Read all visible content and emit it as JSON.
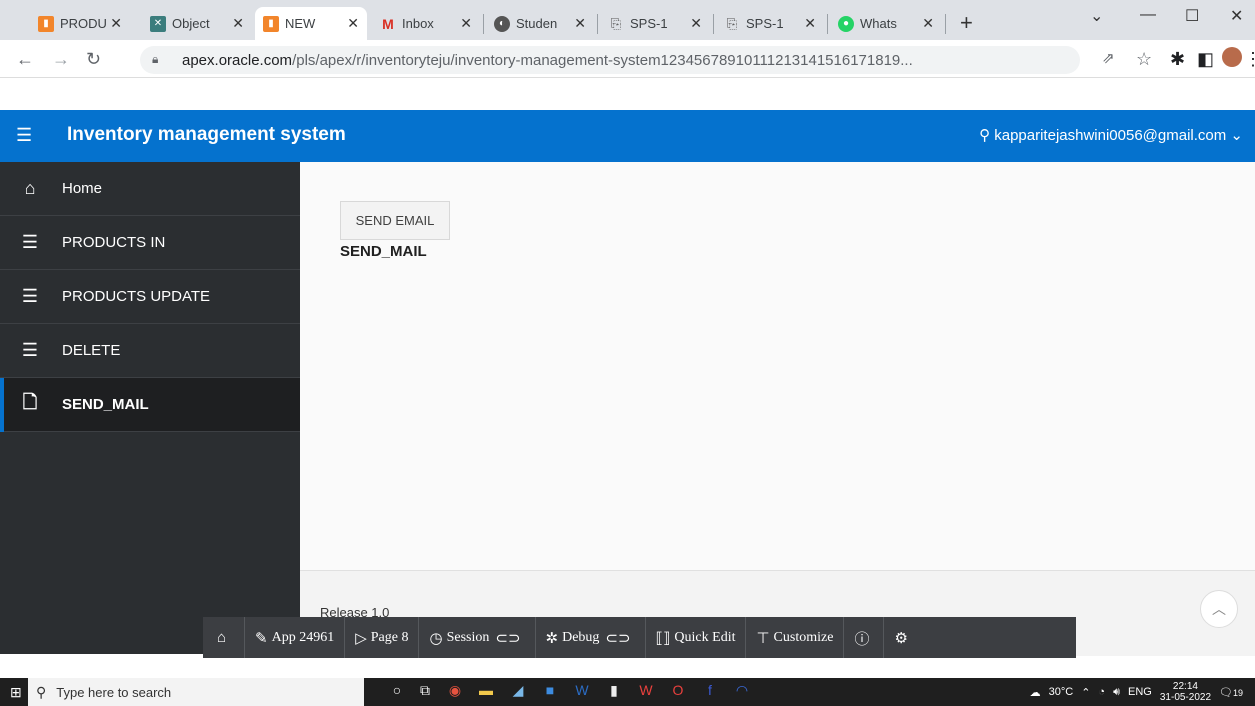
{
  "browser": {
    "tabs": [
      {
        "title": "PRODU",
        "favicon": "apex-icon",
        "color": "#f2852b",
        "active": false
      },
      {
        "title": "Object",
        "favicon": "object-icon",
        "color": "#3b7d7d",
        "active": false
      },
      {
        "title": "NEW",
        "favicon": "apex-icon",
        "color": "#f2852b",
        "active": true
      },
      {
        "title": "Inbox",
        "favicon": "gmail-icon",
        "color": "#d93025",
        "active": false
      },
      {
        "title": "Studen",
        "favicon": "globe-icon",
        "color": "#555555",
        "active": false
      },
      {
        "title": "SPS-1",
        "favicon": "doc-icon",
        "color": "#555555",
        "active": false
      },
      {
        "title": "SPS-1",
        "favicon": "doc-icon",
        "color": "#555555",
        "active": false
      },
      {
        "title": "Whats",
        "favicon": "whatsapp-icon",
        "color": "#25d366",
        "active": false
      }
    ],
    "url_host": "apex.oracle.com",
    "url_path": "/pls/apex/r/inventoryteju/inventory-management-system123456789101112131415161718​19..."
  },
  "app": {
    "title": "Inventory management system",
    "user": "kapparitejashwini0056@gmail.com",
    "accent": "#0572ce"
  },
  "sidebar": {
    "items": [
      {
        "label": "Home",
        "icon": "home-icon"
      },
      {
        "label": "PRODUCTS IN",
        "icon": "form-icon"
      },
      {
        "label": "PRODUCTS UPDATE",
        "icon": "form-icon"
      },
      {
        "label": "DELETE",
        "icon": "form-icon"
      },
      {
        "label": "SEND_MAIL",
        "icon": "file-icon"
      }
    ]
  },
  "main": {
    "button_label": "SEND EMAIL",
    "region_title": "SEND_MAIL"
  },
  "footer": {
    "release": "Release 1.0"
  },
  "devbar": {
    "app": "App 24961",
    "page": "Page 8",
    "session": "Session",
    "debug": "Debug",
    "quick_edit": "Quick Edit",
    "customize": "Customize"
  },
  "taskbar": {
    "search_placeholder": "Type here to search",
    "weather": "30°C",
    "lang": "ENG",
    "time": "22:14",
    "date": "31-05-2022",
    "notifications": "19"
  }
}
